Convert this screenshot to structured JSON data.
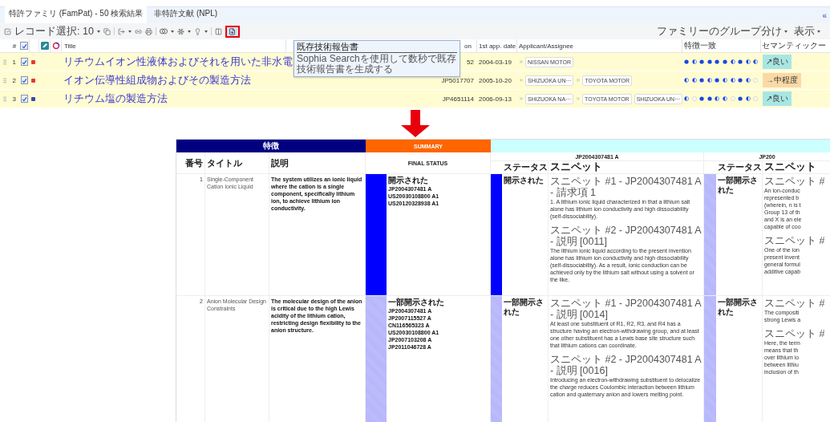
{
  "tabs": [
    {
      "label": "特許ファミリ (FamPat) - 50 検索結果",
      "selected": true
    },
    {
      "label": "非特許文献 (NPL)",
      "selected": false
    }
  ],
  "collapse_glyph": "«",
  "toolbar": {
    "record_select": "レコード選択: 10",
    "right_menus": [
      "ファミリーのグループ分け",
      "表示"
    ]
  },
  "columns": {
    "number": "#",
    "header_checked": true,
    "title": "Title",
    "publication": "on",
    "date": "1st app. date",
    "applicant": "Applicant/Assignee",
    "features": "特徴一致",
    "semantic": "セマンティックー"
  },
  "rows": [
    {
      "index": "1",
      "checked": true,
      "color": "#e53935",
      "title": "リチウムイオン性液体およびそれを用いた非水電",
      "publication": "52",
      "date": "2004-03-19",
      "applicants": [
        {
          "name": "NISSAN MOTOR",
          "expandable": true
        }
      ],
      "matches": [
        {
          "kind": "full"
        },
        {
          "kind": "half"
        },
        {
          "kind": "full"
        },
        {
          "kind": "full"
        },
        {
          "kind": "full"
        },
        {
          "kind": "full"
        },
        {
          "kind": "half"
        },
        {
          "kind": "full"
        },
        {
          "kind": "half"
        },
        {
          "kind": "half"
        }
      ],
      "semantic": {
        "label": "↗良い",
        "kind": "good"
      }
    },
    {
      "index": "2",
      "checked": true,
      "color": "#e53935",
      "title": "イオン伝導性組成物およびその製造方法",
      "publication": "JP5017707",
      "date": "2005-10-20",
      "applicants": [
        {
          "name": "SHIZUOKA UN···",
          "expandable": true
        },
        {
          "name": "TOYOTA MOTOR",
          "expandable": true
        }
      ],
      "matches": [
        {
          "kind": "half"
        },
        {
          "kind": "half"
        },
        {
          "kind": "full"
        },
        {
          "kind": "half"
        },
        {
          "kind": "full"
        },
        {
          "kind": "half"
        },
        {
          "kind": "half"
        },
        {
          "kind": "full"
        },
        {
          "kind": "half"
        },
        {
          "kind": "empty"
        }
      ],
      "semantic": {
        "label": "→中程度",
        "kind": "medium"
      }
    },
    {
      "index": "3",
      "checked": true,
      "color": "#3949ab",
      "title": "リチウム塩の製造方法",
      "publication": "JP4651114",
      "date": "2006-09-13",
      "applicants": [
        {
          "name": "SHIZUOKA NA···",
          "expandable": true
        },
        {
          "name": "TOYOTA MOTOR",
          "expandable": true
        },
        {
          "name": "SHIZUOKA UN···",
          "expandable": false
        }
      ],
      "matches": [
        {
          "kind": "half"
        },
        {
          "kind": "empty"
        },
        {
          "kind": "full"
        },
        {
          "kind": "full"
        },
        {
          "kind": "half"
        },
        {
          "kind": "half"
        },
        {
          "kind": "empty"
        },
        {
          "kind": "full"
        },
        {
          "kind": "half"
        },
        {
          "kind": "empty"
        }
      ],
      "semantic": {
        "label": "↗良い",
        "kind": "good"
      }
    }
  ],
  "tooltip": {
    "title": "既存技術報告書",
    "text": "Sophia Searchを使用して数秒で既存技術報告書を生成する"
  },
  "report": {
    "feature_header": "特徴",
    "summary_header": "SUMMARY",
    "columns": {
      "number": "番号",
      "title": "タイトル",
      "description": "説明",
      "final_status": "FINAL STATUS"
    },
    "documents": [
      {
        "id": "JP2004307481 A",
        "status_header": "ステータス",
        "snippet_header": "スニペット"
      },
      {
        "id": "JP200",
        "status_header": "ステータス",
        "snippet_header": "スニペット"
      }
    ],
    "features": [
      {
        "number": "1",
        "title": "Single-Component Cation Ionic Liquid",
        "description": "The system utilizes an ionic liquid where the cation is a single component, specifically lithium ion, to achieve lithium ion conductivity.",
        "final": {
          "kind": "disclosed",
          "status": "開示された",
          "docs": [
            "JP2004307481 A",
            "US20030108800 A1",
            "US20120328938 A1"
          ]
        },
        "docs": [
          {
            "kind": "disclosed",
            "status": "開示された",
            "snippets": [
              {
                "heading": "スニペット #1 - JP2004307481 A - 請求項 1",
                "text": "1. A lithium ionic liquid characterized in that a lithium salt alone has lithium ion conductivity and high dissociability (self-dissociability)."
              },
              {
                "heading": "スニペット #2 - JP2004307481 A - 説明 [0011]",
                "text": "The lithium ionic liquid according to the present invention alone has lithium ion conductivity and high dissociability (self-dissociability). As a result, ionic conduction can be achieved only by the lithium salt without using a solvent or the like."
              }
            ]
          },
          {
            "kind": "partial",
            "status": "一部開示された",
            "snippets": [
              {
                "heading": "スニペット #",
                "lines": [
                  "An ion-conduc",
                  "represented b",
                  "(wherein, n is t",
                  "Group 13 of th",
                  "and X is an ele",
                  "capable of coo"
                ]
              },
              {
                "heading": "スニペット #",
                "lines": [
                  "One of the ion",
                  "present invent",
                  "general formul",
                  "additive capab"
                ]
              }
            ]
          }
        ]
      },
      {
        "number": "2",
        "title": "Anion Molecular Design Constraints",
        "description": "The molecular design of the anion is critical due to the high Lewis acidity of the lithium cation, restricting design flexibility to the anion structure.",
        "final": {
          "kind": "partial",
          "status": "一部開示された",
          "docs": [
            "JP2004307481 A",
            "JP2007115527 A",
            "CN116565323 A",
            "US20030108800 A1",
            "JP2007103208 A",
            "JP2011046728 A"
          ]
        },
        "docs": [
          {
            "kind": "partial",
            "status": "一部開示された",
            "snippets": [
              {
                "heading": "スニペット #1 - JP2004307481 A - 説明 [0014]",
                "text": "At least one substituent of R1, R2, R3, and R4 has a structure having an electron-withdrawing group, and at least one other substituent has a Lewis base site structure such that lithium cations can coordinate."
              },
              {
                "heading": "スニペット #2 - JP2004307481 A - 説明 [0016]",
                "text": "Introducing an electron-withdrawing substituent to delocalize the charge reduces Coulombic interaction between lithium cation and quaternary anion and lowers melting point."
              }
            ]
          },
          {
            "kind": "partial",
            "status": "一部開示された",
            "snippets": [
              {
                "heading": "スニペット #",
                "lines": [
                  "The compositi",
                  "strong Lewis a"
                ]
              },
              {
                "heading": "スニペット #",
                "lines": [
                  "Here, the term",
                  "means that th",
                  "over lithium io",
                  "between lithiu",
                  "inclusion of th"
                ]
              }
            ]
          }
        ]
      }
    ]
  }
}
